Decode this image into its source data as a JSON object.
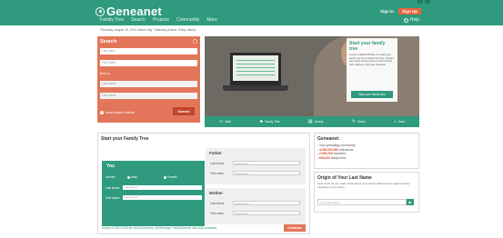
{
  "header": {
    "logo_text": "Geneanet",
    "nav": [
      "Family Tree",
      "Search",
      "Projects",
      "Community",
      "More"
    ],
    "sign_in": "Sign in",
    "sign_up": "Sign Up",
    "help": "Help",
    "help_icon": "?"
  },
  "dateline": "Thursday, August 15, 2019 Name Day: Tarkinsky (Name, Ruby, Marie)",
  "search": {
    "title": "Search",
    "last_name_placeholder": "Last name",
    "first_name_placeholder": "First name",
    "born_label": "Born in",
    "place_placeholder": "Last Name",
    "date_placeholder": "First Name",
    "more_criteria": "more search criteria",
    "more_icon": "+",
    "button": "Search"
  },
  "promo": {
    "title": "Start your family tree",
    "text": "Import a GEDCOM file or to add your family tree from search for free. Upload and share family pictures and connect with relatives, find new relatives!",
    "button": "Start your family tree"
  },
  "iconbar": [
    {
      "icon": "▭",
      "label": "Start"
    },
    {
      "icon": "♣",
      "label": "Family Tree"
    },
    {
      "icon": "▤",
      "label": "Library"
    },
    {
      "icon": "✎",
      "label": "Share"
    },
    {
      "icon": "⌂",
      "label": "Save"
    }
  ],
  "tree": {
    "title": "Start your Family Tree",
    "you": {
      "title": "You",
      "gender_label": "Gender",
      "male": "Male",
      "female": "Female",
      "last_name_label": "Last Name",
      "last_name_value": "Last Name",
      "first_name_label": "First Name",
      "first_name_value": "First name"
    },
    "father": {
      "title": "Father",
      "last_name_label": "Last Name",
      "last_name_placeholder": "Last Name",
      "first_name_label": "First name",
      "first_name_placeholder": "First name"
    },
    "mother": {
      "title": "Mother",
      "last_name_label": "Last Name",
      "last_name_placeholder": "Last Name",
      "first_name_label": "First name",
      "first_name_placeholder": "First name"
    },
    "import_link": "Import a GEDCOM file (from Ancestry, MyHeritage, FamilySearch and any software)",
    "continue": "Continue"
  },
  "stats": {
    "title": "Geneanet:",
    "intro": "- Your genealogy community",
    "lines": [
      {
        "value": "- 4,000,000,000",
        "label": " individuals"
      },
      {
        "value": "- 2,000,000",
        "label": " members"
      },
      {
        "value": "- 600,000",
        "label": " family trees"
      }
    ]
  },
  "origin": {
    "title": "Origin of Your Last Name",
    "text": "How much do you really know about your name? Discover the origin and the meaning of your name.",
    "placeholder": "Your Last Name",
    "go_icon": "▶"
  },
  "colors": {
    "brand_green": "#2f9a7e",
    "accent_orange": "#e3765a",
    "signup": "#e8643c",
    "stat_red": "#d6452b"
  }
}
